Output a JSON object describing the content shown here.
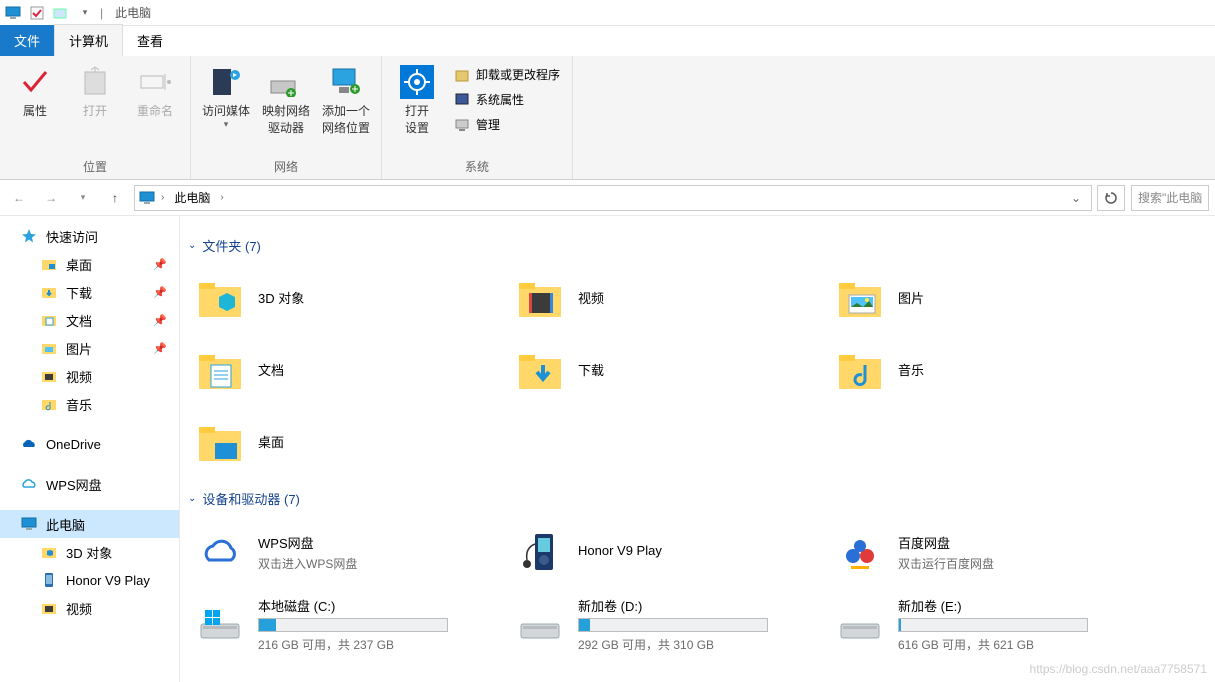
{
  "titlebar": {
    "title": "此电脑",
    "separator": "|"
  },
  "tabs": {
    "file": "文件",
    "computer": "计算机",
    "view": "查看"
  },
  "ribbon": {
    "group_location": "位置",
    "group_network": "网络",
    "group_system": "系统",
    "properties": "属性",
    "open": "打开",
    "rename": "重命名",
    "access_media": "访问媒体",
    "map_drive_l1": "映射网络",
    "map_drive_l2": "驱动器",
    "add_netloc_l1": "添加一个",
    "add_netloc_l2": "网络位置",
    "open_settings_l1": "打开",
    "open_settings_l2": "设置",
    "uninstall": "卸载或更改程序",
    "sys_props": "系统属性",
    "manage": "管理"
  },
  "nav": {
    "breadcrumb": "此电脑",
    "search_placeholder": "搜索\"此电脑"
  },
  "sidebar": {
    "quick": "快速访问",
    "desktop": "桌面",
    "downloads": "下载",
    "documents": "文档",
    "pictures": "图片",
    "videos": "视频",
    "music": "音乐",
    "onedrive": "OneDrive",
    "wps": "WPS网盘",
    "thispc": "此电脑",
    "obj3d": "3D 对象",
    "honor": "Honor V9 Play",
    "videos2": "视频"
  },
  "sections": {
    "folders": "文件夹 (7)",
    "devices": "设备和驱动器 (7)"
  },
  "folders": [
    {
      "name": "3D 对象"
    },
    {
      "name": "视频"
    },
    {
      "name": "图片"
    },
    {
      "name": "文档"
    },
    {
      "name": "下载"
    },
    {
      "name": "音乐"
    },
    {
      "name": "桌面"
    }
  ],
  "devices": {
    "wps": {
      "name": "WPS网盘",
      "sub": "双击进入WPS网盘"
    },
    "honor": {
      "name": "Honor V9 Play",
      "sub": ""
    },
    "baidu": {
      "name": "百度网盘",
      "sub": "双击运行百度网盘"
    },
    "c": {
      "name": "本地磁盘 (C:)",
      "sub": "216 GB 可用，共 237 GB",
      "pct": 9
    },
    "d": {
      "name": "新加卷 (D:)",
      "sub": "292 GB 可用，共 310 GB",
      "pct": 6
    },
    "e": {
      "name": "新加卷 (E:)",
      "sub": "616 GB 可用，共 621 GB",
      "pct": 1
    }
  },
  "watermark": "https://blog.csdn.net/aaa7758571"
}
